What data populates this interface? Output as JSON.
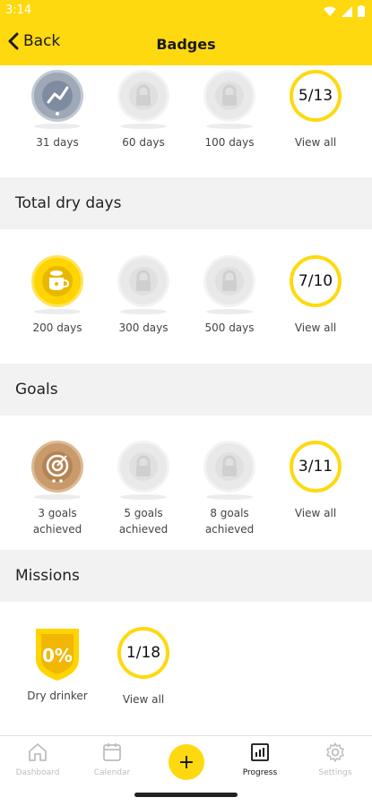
{
  "status_bar": {
    "time": "3:14"
  },
  "header": {
    "back_label": "Back",
    "title": "Badges"
  },
  "sections": [
    {
      "title": "",
      "badges": [
        {
          "label": "31 days",
          "state": "earned",
          "icon": "streak-chart-icon"
        },
        {
          "label": "60 days",
          "state": "locked",
          "icon": "lock-icon"
        },
        {
          "label": "100 days",
          "state": "locked",
          "icon": "lock-icon"
        }
      ],
      "view_all": {
        "count": "5/13",
        "label": "View all"
      }
    },
    {
      "title": "Total dry days",
      "badges": [
        {
          "label": "200 days",
          "state": "earned",
          "icon": "cup-icon"
        },
        {
          "label": "300 days",
          "state": "locked",
          "icon": "lock-icon"
        },
        {
          "label": "500 days",
          "state": "locked",
          "icon": "lock-icon"
        }
      ],
      "view_all": {
        "count": "7/10",
        "label": "View all"
      }
    },
    {
      "title": "Goals",
      "badges": [
        {
          "label_line1": "3 goals",
          "label_line2": "achieved",
          "state": "earned",
          "icon": "target-icon"
        },
        {
          "label_line1": "5 goals",
          "label_line2": "achieved",
          "state": "locked",
          "icon": "lock-icon"
        },
        {
          "label_line1": "8 goals",
          "label_line2": "achieved",
          "state": "locked",
          "icon": "lock-icon"
        }
      ],
      "view_all": {
        "count": "3/11",
        "label": "View all"
      }
    },
    {
      "title": "Missions",
      "badges": [
        {
          "label": "Dry drinker",
          "state": "earned",
          "icon": "zero-percent-shield-icon",
          "icon_text": "0%"
        }
      ],
      "view_all": {
        "count": "1/18",
        "label": "View all"
      }
    }
  ],
  "bottom_nav": {
    "items": [
      {
        "label": "Dashboard",
        "icon": "home-icon",
        "active": false
      },
      {
        "label": "Calendar",
        "icon": "calendar-icon",
        "active": false
      },
      {
        "label": "+",
        "icon": "add-icon"
      },
      {
        "label": "Progress",
        "icon": "chart-icon",
        "active": true
      },
      {
        "label": "Settings",
        "icon": "gear-icon",
        "active": false
      }
    ]
  },
  "colors": {
    "accent": "#FFD90F",
    "section_bg": "#F2F2F2",
    "gold_badge": "#FFD400",
    "bronze_badge": "#C99A6B",
    "silver_badge": "#9FA8B7"
  }
}
